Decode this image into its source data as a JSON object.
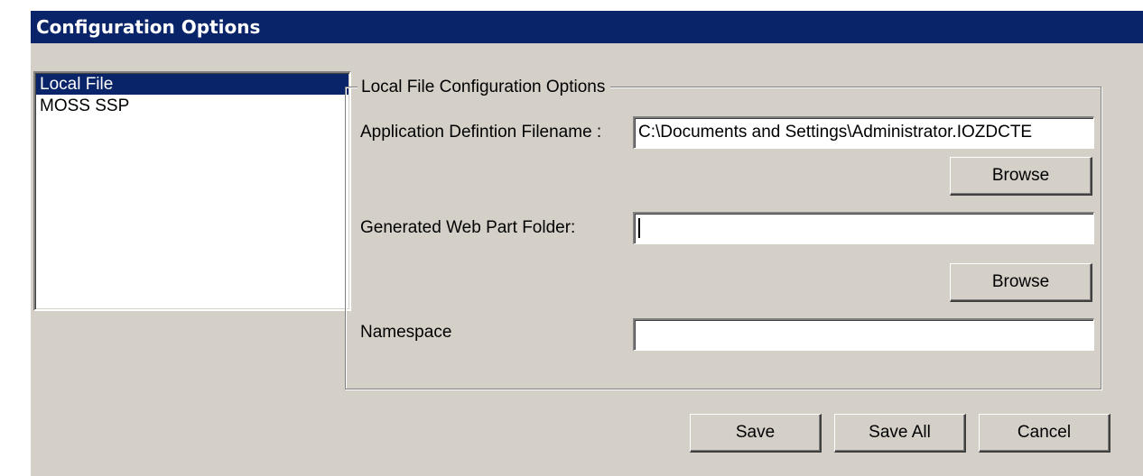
{
  "window": {
    "title": "Configuration Options"
  },
  "list": {
    "items": [
      {
        "label": "Local File",
        "selected": true
      },
      {
        "label": "MOSS SSP",
        "selected": false
      }
    ]
  },
  "group": {
    "title": "Local File Configuration Options",
    "app_def_label": "Application Defintion Filename :",
    "app_def_value": "C:\\Documents and Settings\\Administrator.IOZDCTE",
    "browse1_label": "Browse",
    "webpart_folder_label": "Generated Web Part Folder:",
    "webpart_folder_value": "",
    "browse2_label": "Browse",
    "namespace_label": "Namespace",
    "namespace_value": ""
  },
  "footer": {
    "save_label": "Save",
    "save_all_label": "Save All",
    "cancel_label": "Cancel"
  },
  "colors": {
    "titlebar": "#0a246a",
    "face": "#d4d0c8",
    "selection": "#0a246a"
  }
}
